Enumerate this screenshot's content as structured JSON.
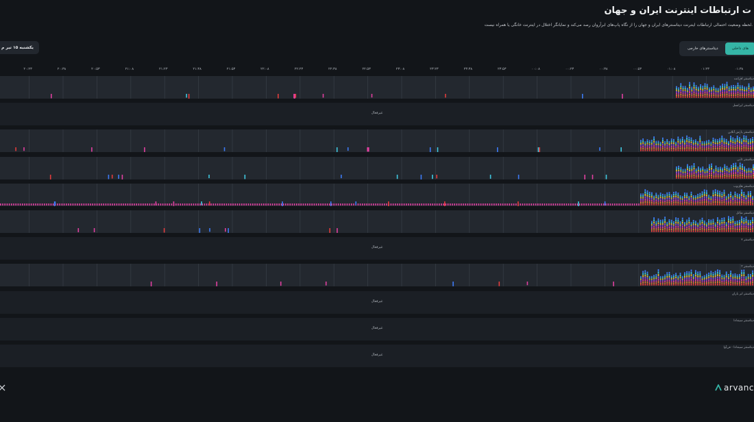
{
  "header": {
    "title": "ت ارتباطات اینترنت ایران و جهان",
    "subtitle": "لحظه وضعیت احتمالی ارتباطات اینترنت دیتاسنترهای ایران و جهان را از نگاه پاپ‌های ابرآروان رصد می‌کند و نمایانگر اختلال در اینترنت خانگی یا همراه نیست."
  },
  "tabs": [
    {
      "label": "های داخلی",
      "active": true
    },
    {
      "label": "دیتاسنترهای خارجی",
      "active": false
    }
  ],
  "date_button": {
    "label": "یکشنبه ۱۵ تیر م"
  },
  "time_axis": [
    "۰۱:۳۸",
    "۰۱:۲۳",
    "۰۱:۰۸",
    "۰۰:۵۳",
    "۰۰:۳۸",
    "۰۰:۲۳",
    "۰۰:۰۸",
    "۲۳:۵۳",
    "۲۳:۳۸",
    "۲۳:۲۳",
    "۲۳:۰۸",
    "۲۲:۵۳",
    "۲۲:۳۸",
    "۲۲:۲۳",
    "۲۲:۰۸",
    "۲۱:۵۳",
    "۲۱:۳۸",
    "۲۱:۲۳",
    "۲۱:۰۸",
    "۲۰:۵۳",
    "۲۰:۳۸",
    "۲۰:۲۳"
  ],
  "rows": [
    {
      "label": "دیتاسنتر افرانت",
      "offline": false
    },
    {
      "label": "دیتاسنتر ایرانسل",
      "offline": true,
      "status": "غیرفعال"
    },
    {
      "label": "دیتاسنتر پارس آنلاین",
      "offline": false
    },
    {
      "label": "دیتاسنتر ثامن",
      "offline": false
    },
    {
      "label": "دیتاسنتر های‌وب",
      "offline": false
    },
    {
      "label": "دیتاسنتر شاتل",
      "offline": false
    },
    {
      "label": "دیتاسنتر ۲",
      "offline": true,
      "status": "غیرفعال"
    },
    {
      "label": "دیتاسنتر ۳",
      "offline": false
    },
    {
      "label": "دیتاسنتر ابر باران",
      "offline": true,
      "status": "غیرفعال"
    },
    {
      "label": "دیتاسنتر سیندادا",
      "offline": true,
      "status": "غیرفعال"
    },
    {
      "label": "دیتاسنتر سیندادا - فن‌آوا",
      "offline": true,
      "status": "غیرفعال"
    }
  ],
  "footer": {
    "logo_text": "arvanc"
  },
  "colors": {
    "accent": "#35b5a6",
    "pink": "#e040a0",
    "blue": "#3d7bf5",
    "red": "#e23c3c",
    "purple": "#8a4fe0",
    "orange": "#e07f3c",
    "yellow": "#e0c040",
    "cyan": "#40c8e0"
  }
}
